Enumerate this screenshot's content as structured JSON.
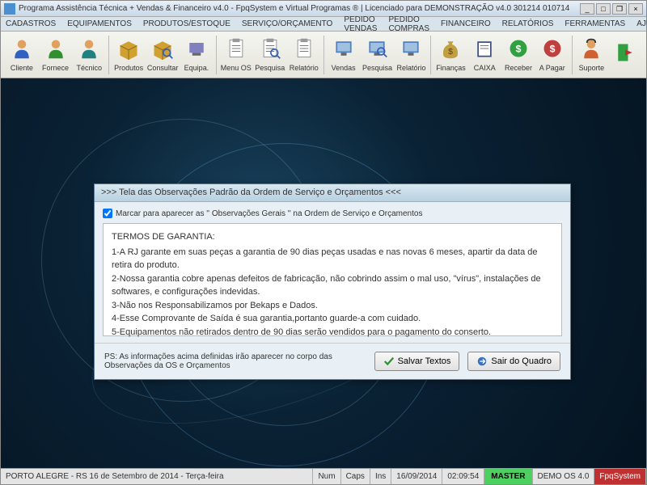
{
  "titlebar": {
    "title": "Programa Assistência Técnica + Vendas & Financeiro v4.0 - FpqSystem e Virtual Programas ® | Licenciado para  DEMONSTRAÇÃO v4.0 301214 010714"
  },
  "menu": {
    "items": [
      "CADASTROS",
      "EQUIPAMENTOS",
      "PRODUTOS/ESTOQUE",
      "SERVIÇO/ORÇAMENTO",
      "PEDIDO VENDAS",
      "PEDIDO COMPRAS",
      "FINANCEIRO",
      "RELATÓRIOS",
      "FERRAMENTAS",
      "AJUDA"
    ]
  },
  "toolbar": {
    "items": [
      {
        "label": "Cliente",
        "icon": "person-blue"
      },
      {
        "label": "Fornece",
        "icon": "person-green"
      },
      {
        "label": "Técnico",
        "icon": "person-teal"
      },
      {
        "sep": true
      },
      {
        "label": "Produtos",
        "icon": "box"
      },
      {
        "label": "Consultar",
        "icon": "box-search"
      },
      {
        "label": "Equipa.",
        "icon": "equipment"
      },
      {
        "sep": true
      },
      {
        "label": "Menu OS",
        "icon": "clipboard"
      },
      {
        "label": "Pesquisa",
        "icon": "clipboard-search"
      },
      {
        "label": "Relatório",
        "icon": "clipboard-report"
      },
      {
        "sep": true
      },
      {
        "label": "Vendas",
        "icon": "monitor"
      },
      {
        "label": "Pesquisa",
        "icon": "monitor-search"
      },
      {
        "label": "Relatório",
        "icon": "monitor-report"
      },
      {
        "sep": true
      },
      {
        "label": "Finanças",
        "icon": "money-bag"
      },
      {
        "label": "CAIXA",
        "icon": "ledger"
      },
      {
        "label": "Receber",
        "icon": "coin-green"
      },
      {
        "label": "A Pagar",
        "icon": "coin-red"
      },
      {
        "sep": true
      },
      {
        "label": "Suporte",
        "icon": "support"
      },
      {
        "label": "",
        "icon": "exit"
      }
    ]
  },
  "dialog": {
    "title": ">>>  Tela das Observações Padrão da Ordem de Serviço e Orçamentos  <<<",
    "checkbox_label": "Marcar para aparecer as '' Observações Gerais '' na Ordem de Serviço e Orçamentos",
    "checkbox_checked": true,
    "terms_header": "TERMOS DE GARANTIA:",
    "terms_lines": [
      "1-A RJ garante em suas peças a garantia de 90 dias peças usadas e nas novas 6 meses, apartir da data de retira do produto.",
      "2-Nossa garantia cobre apenas defeitos de fabricação, não cobrindo assim o mal uso, \"vírus\",   instalações  de softwares, e configurações indevidas.",
      "3-Não nos Responsabilizamos por Bekaps e Dados.",
      "4-Esse Comprovante de Saída é sua garantia,portanto guarde-a com cuidado.",
      "5-Equipamentos não retirados dentro de 90 dias serão vendidos para o pagamento do conserto."
    ],
    "ps": "PS: As informações acima definidas irão aparecer no corpo das Observações da OS e Orçamentos",
    "btn_save": "Salvar Textos",
    "btn_exit": "Sair do Quadro"
  },
  "statusbar": {
    "location": "PORTO ALEGRE - RS 16 de Setembro de 2014 - Terça-feira",
    "num": "Num",
    "caps": "Caps",
    "ins": "Ins",
    "date": "16/09/2014",
    "time": "02:09:54",
    "master": "MASTER",
    "demo": "DEMO OS 4.0",
    "brand": "FpqSystem"
  },
  "colors": {
    "accent": "#4a90d0",
    "ok": "#2a9030",
    "danger": "#c03030"
  }
}
